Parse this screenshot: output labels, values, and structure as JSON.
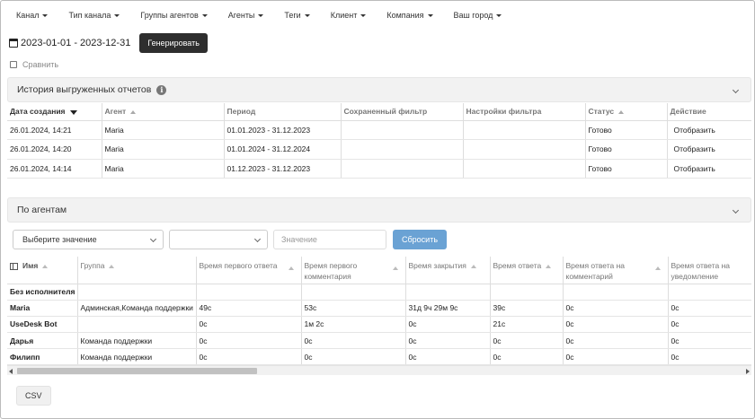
{
  "filters": [
    "Канал",
    "Тип канала",
    "Группы агентов",
    "Агенты",
    "Теги",
    "Клиент",
    "Компания",
    "Ваш город"
  ],
  "date_range": "2023-01-01 - 2023-12-31",
  "generate_label": "Генерировать",
  "compare_label": "Сравнить",
  "history": {
    "title": "История выгруженных отчетов",
    "columns": [
      "Дата создания",
      "Агент",
      "Период",
      "Сохраненный фильтр",
      "Настройки фильтра",
      "Статус",
      "Действие"
    ],
    "rows": [
      {
        "created": "26.01.2024, 14:21",
        "agent": "Maria",
        "period": "01.01.2023 - 31.12.2023",
        "saved_filter": "",
        "filter_settings": "",
        "status": "Готово",
        "action": "Отобразить"
      },
      {
        "created": "26.01.2024, 14:20",
        "agent": "Maria",
        "period": "01.01.2024 - 31.12.2024",
        "saved_filter": "",
        "filter_settings": "",
        "status": "Готово",
        "action": "Отобразить"
      },
      {
        "created": "26.01.2024, 14:14",
        "agent": "Maria",
        "period": "01.12.2023 - 31.12.2023",
        "saved_filter": "",
        "filter_settings": "",
        "status": "Готово",
        "action": "Отобразить"
      }
    ]
  },
  "agents": {
    "title": "По агентам",
    "select_placeholder": "Выберите значение",
    "select2_value": "",
    "value_placeholder": "Значение",
    "reset_label": "Сбросить",
    "columns": [
      "Имя",
      "Группа",
      "Время первого ответа",
      "Время первого комментария",
      "Время закрытия",
      "Время ответа",
      "Время ответа на комментарий",
      "Время ответа на уведомление"
    ],
    "rows": [
      {
        "name": "Без исполнителя",
        "group": "",
        "first_response": "",
        "first_comment": "",
        "close_time": "",
        "response": "",
        "comment_response": "",
        "notice_response": ""
      },
      {
        "name": "Maria",
        "group": "Админская,Команда поддержки",
        "first_response": "49с",
        "first_comment": "53с",
        "close_time": "31д 9ч 29м 9с",
        "response": "39с",
        "comment_response": "0с",
        "notice_response": "0с"
      },
      {
        "name": "UseDesk Bot",
        "group": "",
        "first_response": "0с",
        "first_comment": "1м 2с",
        "close_time": "0с",
        "response": "21с",
        "comment_response": "0с",
        "notice_response": "0с"
      },
      {
        "name": "Дарья",
        "group": "Команда поддержки",
        "first_response": "0с",
        "first_comment": "0с",
        "close_time": "0с",
        "response": "0с",
        "comment_response": "0с",
        "notice_response": "0с"
      },
      {
        "name": "Филипп",
        "group": "Команда поддержки",
        "first_response": "0с",
        "first_comment": "0с",
        "close_time": "0с",
        "response": "0с",
        "comment_response": "0с",
        "notice_response": "0с"
      }
    ]
  },
  "csv_label": "CSV"
}
